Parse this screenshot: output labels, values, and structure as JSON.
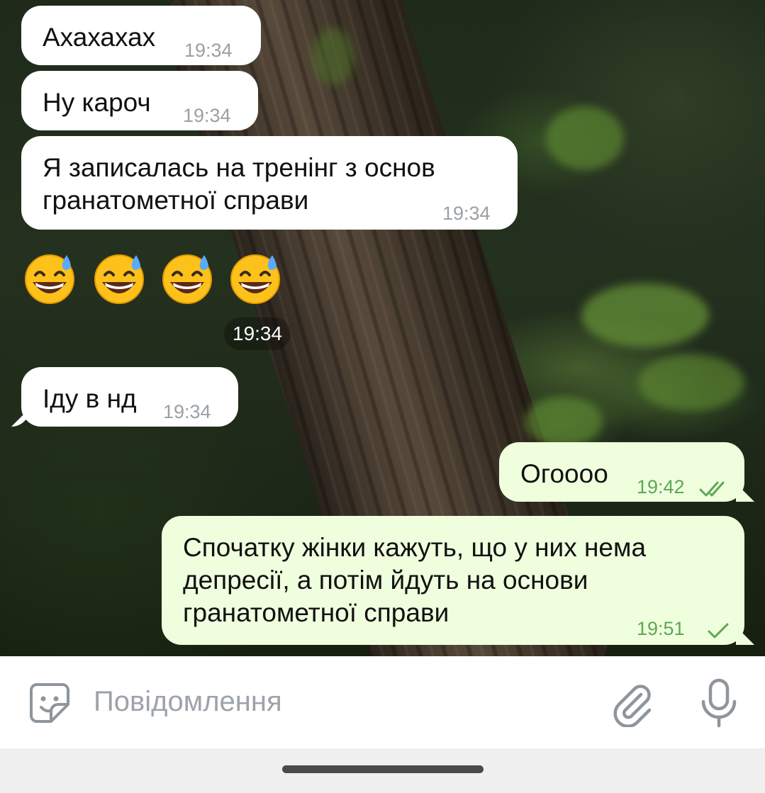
{
  "colors": {
    "incoming_bubble": "#ffffff",
    "outgoing_bubble": "#efffde",
    "incoming_time": "#9aa0a6",
    "outgoing_time": "#5ca853",
    "placeholder": "#9da3a9"
  },
  "messages": [
    {
      "direction": "incoming",
      "text": "Ахахахах",
      "time": "19:34"
    },
    {
      "direction": "incoming",
      "text": "Ну кароч",
      "time": "19:34"
    },
    {
      "direction": "incoming",
      "line1": "Я записалась на тренінг з основ",
      "line2": "гранатометної справи",
      "time": "19:34"
    },
    {
      "direction": "incoming",
      "type": "emoji",
      "emoji": [
        "😅",
        "😅",
        "😅",
        "😅"
      ],
      "time": "19:34"
    },
    {
      "direction": "incoming",
      "text": "Іду в нд",
      "time": "19:34"
    },
    {
      "direction": "outgoing",
      "text": "Огоооо",
      "time": "19:42",
      "status": "read",
      "status_icon": "double-check-icon"
    },
    {
      "direction": "outgoing",
      "line1": "Спочатку жінки кажуть, що у них нема",
      "line2": "депресії, а потім йдуть на основи",
      "line3": "гранатометної справи",
      "time": "19:51",
      "status": "sent",
      "status_icon": "check-icon"
    }
  ],
  "input": {
    "placeholder": "Повідомлення",
    "value": "",
    "icons": [
      "sticker-icon",
      "paperclip-icon",
      "microphone-icon"
    ]
  }
}
